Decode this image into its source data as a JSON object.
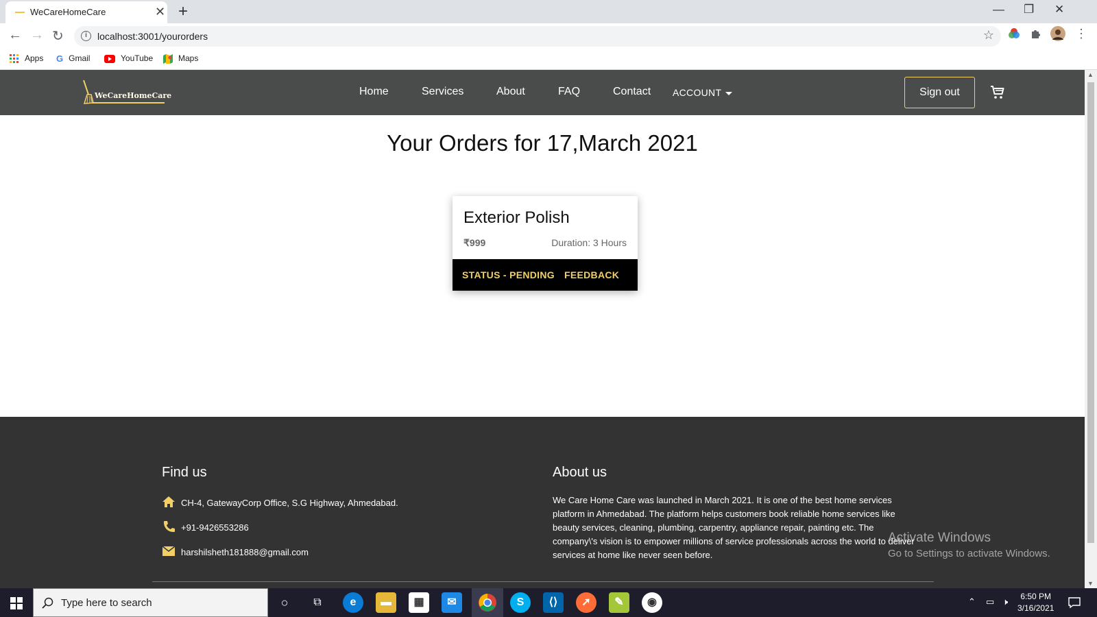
{
  "browser": {
    "tab_title": "WeCareHomeCare",
    "url": "localhost:3001/yourorders",
    "bookmarks": [
      "Apps",
      "Gmail",
      "YouTube",
      "Maps"
    ]
  },
  "site": {
    "logo_text": "WeCareHomeCare",
    "nav": [
      "Home",
      "Services",
      "About",
      "FAQ",
      "Contact"
    ],
    "account_label": "ACCOUNT",
    "signout_label": "Sign out"
  },
  "orders": {
    "heading": "Your Orders for 17,March 2021",
    "items": [
      {
        "title": "Exterior Polish",
        "price": "₹999",
        "duration": "Duration: 3 Hours",
        "status": "STATUS - PENDING",
        "feedback": "FEEDBACK"
      }
    ]
  },
  "footer": {
    "find_us_heading": "Find us",
    "address": "CH-4, GatewayCorp Office, S.G Highway, Ahmedabad.",
    "phone": "+91-9426553286",
    "email": "harshilsheth181888@gmail.com",
    "about_heading": "About us",
    "about_text": "We Care Home Care was launched in March 2021. It is one of the best home services platform in Ahmedabad. The platform helps customers book reliable home services like beauty services, cleaning, plumbing, carpentry, appliance repair, painting etc. The company\\'s vision is to empower millions of service professionals across the world to deliver services at home like never seen before."
  },
  "watermark": {
    "line1": "Activate Windows",
    "line2": "Go to Settings to activate Windows."
  },
  "taskbar": {
    "search_placeholder": "Type here to search",
    "time": "6:50 PM",
    "date": "3/16/2021"
  },
  "colors": {
    "navbar_bg": "#4a4b4b",
    "accent": "#f3d067",
    "footer_bg": "#333333"
  }
}
